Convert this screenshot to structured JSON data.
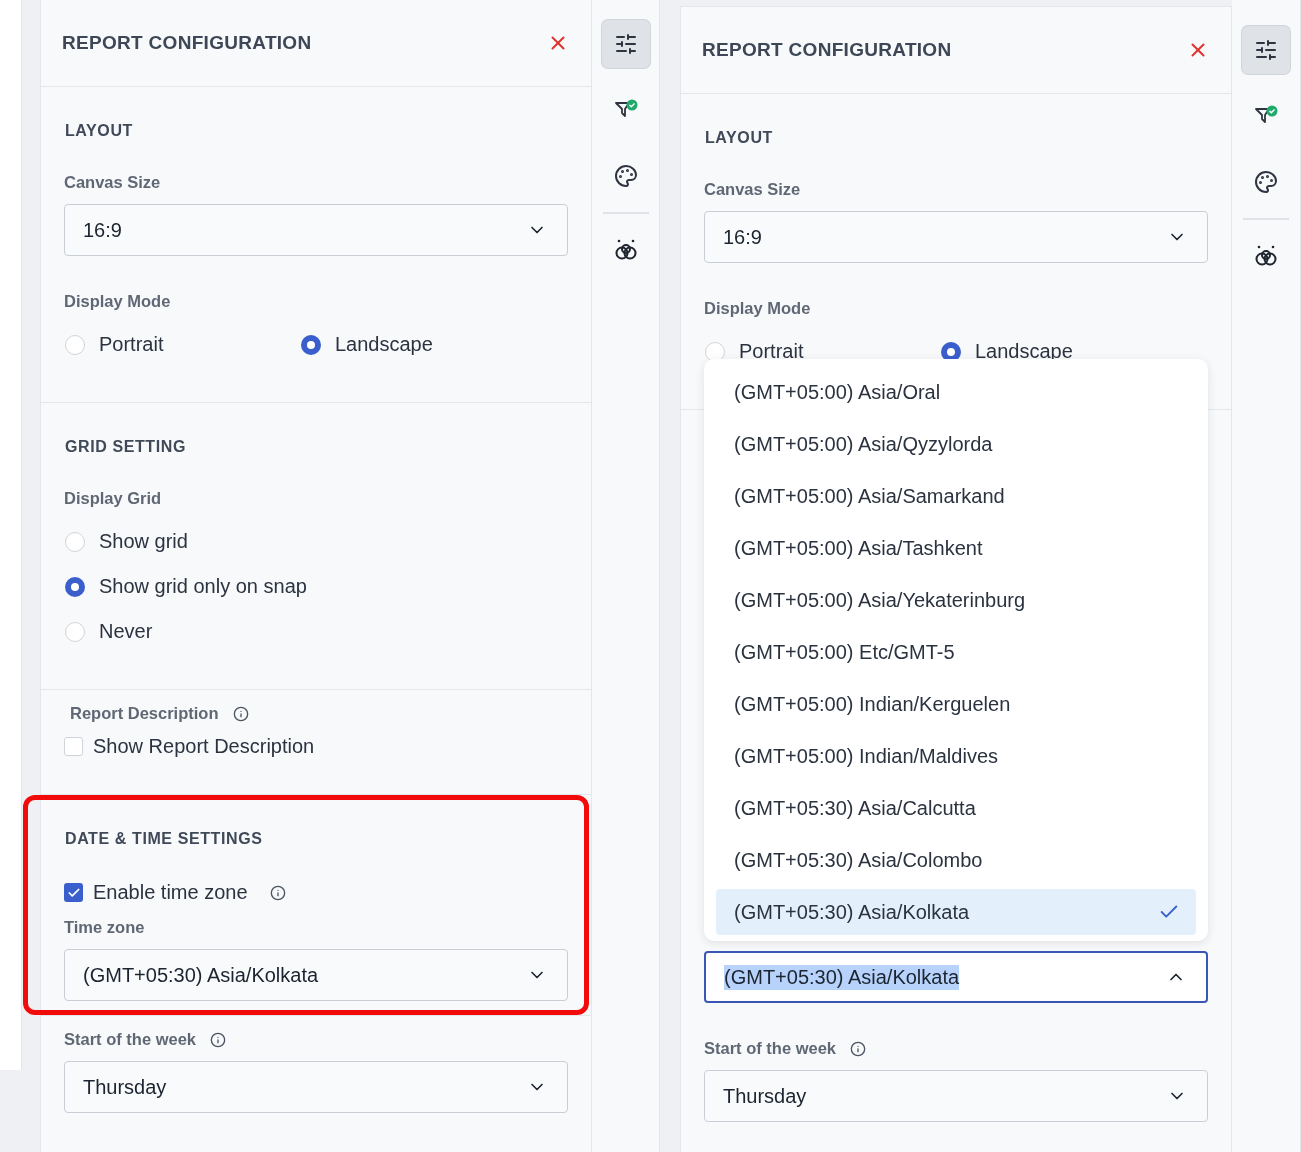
{
  "panels": [
    {
      "title": "REPORT CONFIGURATION",
      "rail": [
        {
          "kind": "tune",
          "selected": true
        },
        {
          "kind": "filter",
          "selected": false
        },
        {
          "kind": "palette",
          "selected": false
        },
        {
          "kind": "rings",
          "selected": false
        }
      ],
      "sections": [
        {
          "title": "LAYOUT",
          "fields": [
            {
              "kind": "select",
              "label": "Canvas Size",
              "value": "16:9"
            },
            {
              "kind": "radios",
              "label": "Display Mode",
              "inline": true,
              "options": [
                {
                  "label": "Portrait",
                  "selected": false
                },
                {
                  "label": "Landscape",
                  "selected": true
                }
              ]
            }
          ]
        },
        {
          "title": "GRID SETTING",
          "fields": [
            {
              "kind": "radios",
              "label": "Display Grid",
              "inline": false,
              "options": [
                {
                  "label": "Show grid",
                  "selected": false
                },
                {
                  "label": "Show grid only on snap",
                  "selected": true
                },
                {
                  "label": "Never",
                  "selected": false
                }
              ]
            }
          ]
        },
        {
          "fields": [
            {
              "kind": "heading",
              "label": "Report Description",
              "info": true
            },
            {
              "kind": "checkbox",
              "label": "Show Report Description",
              "checked": false
            }
          ]
        },
        {
          "title": "DATE & TIME SETTINGS",
          "highlighted": true,
          "fields": [
            {
              "kind": "checkbox",
              "label": "Enable time zone",
              "checked": true,
              "info": true
            },
            {
              "kind": "select",
              "label": "Time zone",
              "value": "(GMT+05:30) Asia/Kolkata"
            }
          ]
        },
        {
          "fields": [
            {
              "kind": "select",
              "label": "Start of the week",
              "info": true,
              "value": "Thursday"
            }
          ]
        }
      ]
    },
    {
      "title": "REPORT CONFIGURATION",
      "rail": [
        {
          "kind": "tune",
          "selected": true
        },
        {
          "kind": "filter",
          "selected": false
        },
        {
          "kind": "palette",
          "selected": false
        },
        {
          "kind": "rings",
          "selected": false
        }
      ],
      "sections": [
        {
          "title": "LAYOUT",
          "fields": [
            {
              "kind": "select",
              "label": "Canvas Size",
              "value": "16:9"
            },
            {
              "kind": "radios",
              "label": "Display Mode",
              "inline": true,
              "options": [
                {
                  "label": "Portrait",
                  "selected": false
                },
                {
                  "label": "Landscape",
                  "selected": true
                }
              ]
            }
          ]
        },
        {
          "covered": true,
          "fields": [
            {
              "kind": "select",
              "value": "(GMT+05:30) Asia/Kolkata",
              "open": true,
              "text_selected": true,
              "options": [
                {
                  "label": "(GMT+05:00) Asia/Oral",
                  "selected": false
                },
                {
                  "label": "(GMT+05:00) Asia/Qyzylorda",
                  "selected": false
                },
                {
                  "label": "(GMT+05:00) Asia/Samarkand",
                  "selected": false
                },
                {
                  "label": "(GMT+05:00) Asia/Tashkent",
                  "selected": false
                },
                {
                  "label": "(GMT+05:00) Asia/Yekaterinburg",
                  "selected": false
                },
                {
                  "label": "(GMT+05:00) Etc/GMT-5",
                  "selected": false
                },
                {
                  "label": "(GMT+05:00) Indian/Kerguelen",
                  "selected": false
                },
                {
                  "label": "(GMT+05:00) Indian/Maldives",
                  "selected": false
                },
                {
                  "label": "(GMT+05:30) Asia/Calcutta",
                  "selected": false
                },
                {
                  "label": "(GMT+05:30) Asia/Colombo",
                  "selected": false
                },
                {
                  "label": "(GMT+05:30) Asia/Kolkata",
                  "selected": true
                }
              ]
            },
            {
              "kind": "select",
              "label": "Start of the week",
              "info": true,
              "value": "Thursday"
            }
          ]
        }
      ]
    }
  ]
}
